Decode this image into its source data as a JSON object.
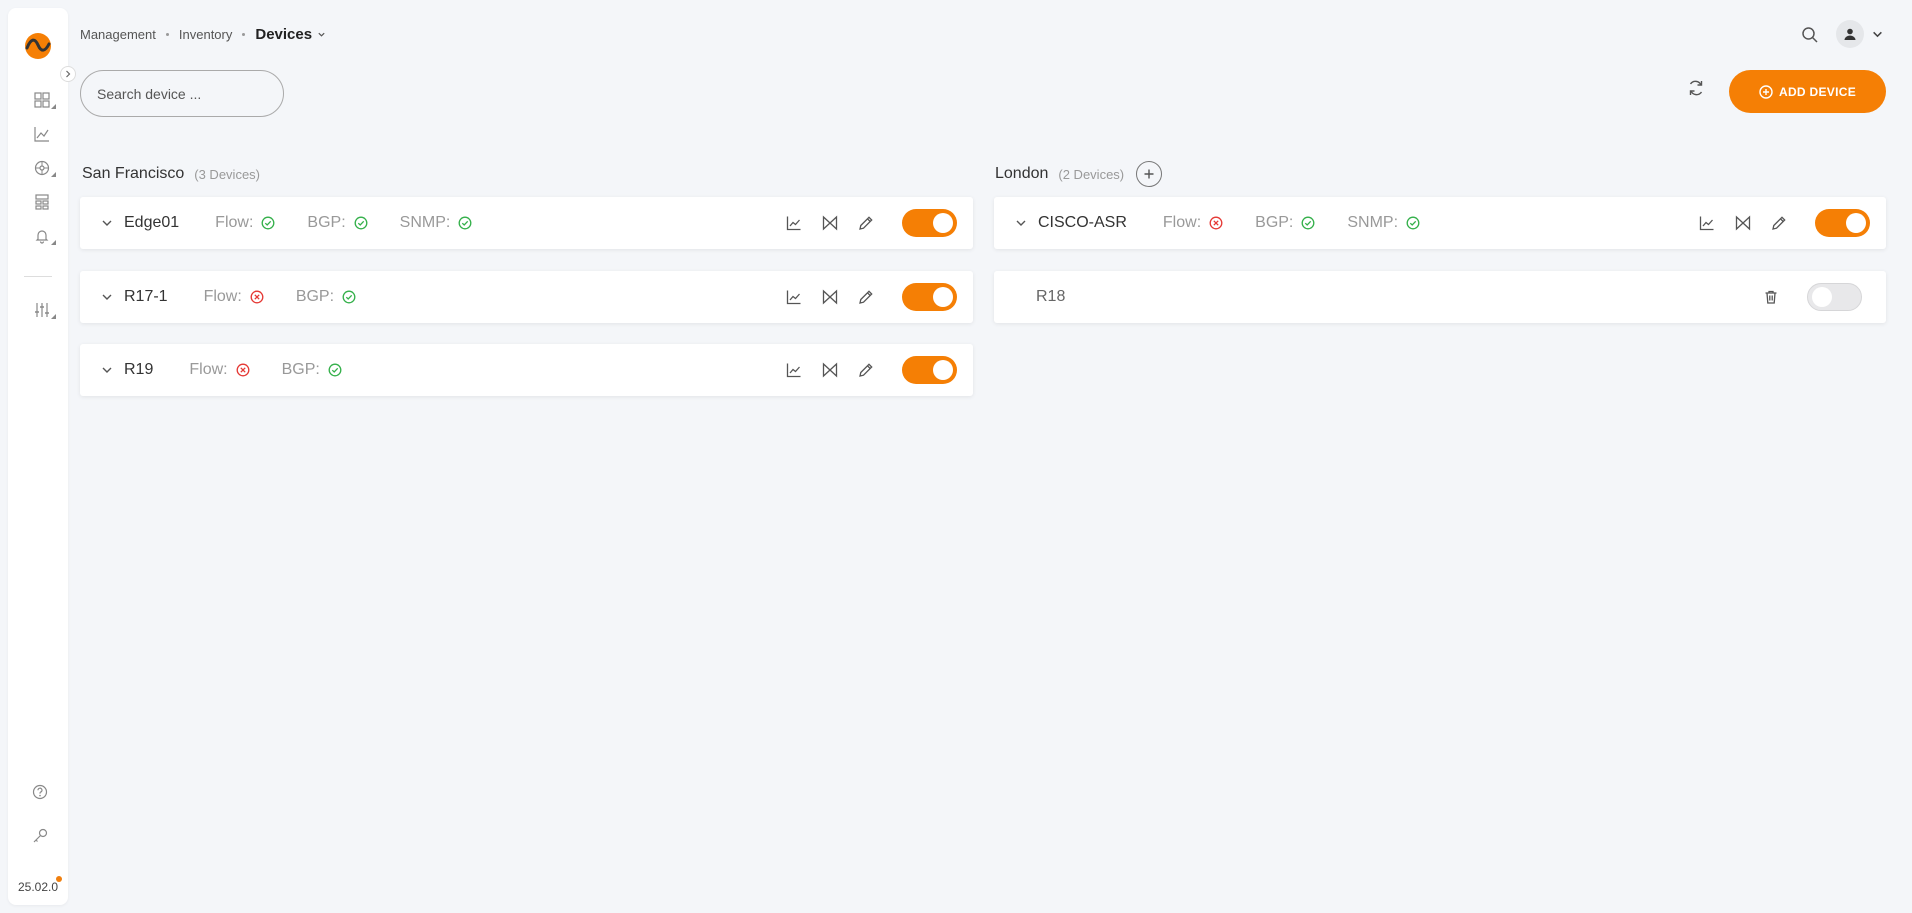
{
  "sidebar": {
    "version": "25.02.0",
    "icons": [
      "dashboard-icon",
      "chart-icon",
      "network-icon",
      "topology-icon",
      "bell-icon",
      "sliders-icon",
      "help-icon",
      "key-icon"
    ]
  },
  "breadcrumb": {
    "items": [
      "Management",
      "Inventory"
    ],
    "current": "Devices"
  },
  "search": {
    "placeholder": "Search device ..."
  },
  "toolbar": {
    "add_label": "ADD DEVICE"
  },
  "colors": {
    "accent": "#f57f05",
    "ok": "#34b04a",
    "error": "#e53935"
  },
  "groups": [
    {
      "name": "San Francisco",
      "count": "(3 Devices)",
      "devices": [
        {
          "name": "Edge01",
          "flow_label": "Flow:",
          "flow": "ok",
          "bgp_label": "BGP:",
          "bgp": "ok",
          "snmp_label": "SNMP:",
          "snmp": "ok",
          "enabled": true
        },
        {
          "name": "R17-1",
          "flow_label": "Flow:",
          "flow": "error",
          "bgp_label": "BGP:",
          "bgp": "ok",
          "enabled": true
        },
        {
          "name": "R19",
          "flow_label": "Flow:",
          "flow": "error",
          "bgp_label": "BGP:",
          "bgp": "ok",
          "enabled": true
        }
      ]
    },
    {
      "name": "London",
      "count": "(2 Devices)",
      "devices": [
        {
          "name": "CISCO-ASR",
          "flow_label": "Flow:",
          "flow": "error",
          "bgp_label": "BGP:",
          "bgp": "ok",
          "snmp_label": "SNMP:",
          "snmp": "ok",
          "enabled": true
        },
        {
          "name": "R18",
          "enabled": false
        }
      ]
    }
  ]
}
